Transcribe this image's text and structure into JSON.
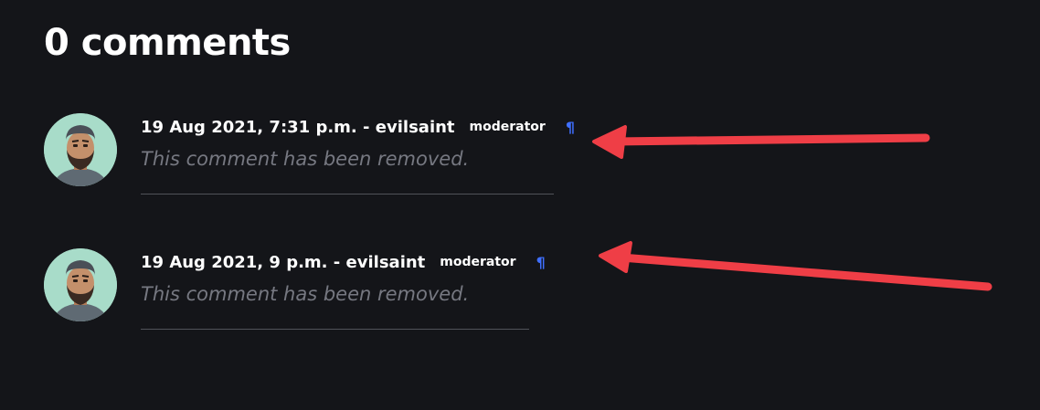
{
  "page": {
    "heading": "0 comments"
  },
  "comments": [
    {
      "date": "19 Aug 2021, 7:31 p.m.",
      "separator": " - ",
      "author": "evilsaint",
      "badge": "moderator",
      "permalink": "¶",
      "text": "This comment has been removed."
    },
    {
      "date": "19 Aug 2021, 9 p.m.",
      "separator": " - ",
      "author": "evilsaint",
      "badge": "moderator",
      "permalink": "¶",
      "text": "This comment has been removed."
    }
  ],
  "icons": {
    "avatar": "avatar-icon",
    "annotation_arrow": "arrow-left-icon"
  },
  "colors": {
    "background": "#141519",
    "text": "#ffffff",
    "muted": "#767881",
    "permalink": "#3f6fff",
    "arrow": "#ef3e46",
    "avatar_bg": "#a8dcc9"
  }
}
